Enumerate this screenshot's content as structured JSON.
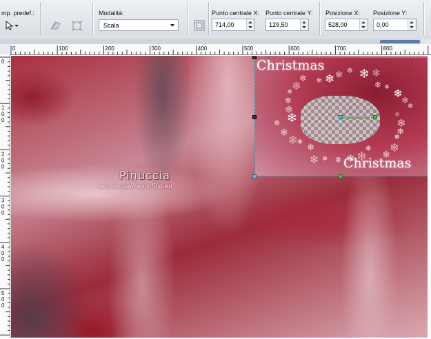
{
  "toolbar": {
    "preset_label": "mp. predef.:",
    "mode_label": "Modalità:",
    "mode_value": "Scala",
    "center_x_label": "Punto centrale X:",
    "center_x_value": "714,00",
    "center_y_label": "Punto centrale Y:",
    "center_y_value": "129,50",
    "pos_x_label": "Posizione X:",
    "pos_x_value": "528,00",
    "pos_y_label": "Posizione Y:",
    "pos_y_value": "0,00"
  },
  "ruler_top_ticks": [
    "0",
    "100",
    "200",
    "300",
    "400",
    "500",
    "600",
    "700",
    "800"
  ],
  "ruler_left_ticks": [
    "0",
    "1\n0\n0",
    "2\n0\n0",
    "3\n0\n0",
    "4\n0\n0",
    "5\n0\n0"
  ],
  "canvas": {
    "watermark_name": "Pinuccia",
    "watermark_url": "www.maidiregrafica.eu",
    "layer_title_top": "Christmas",
    "layer_title_bottom": "Christmas"
  },
  "icons": {
    "pointer": "pointer-arrow-icon",
    "flip": "flip-icon",
    "transform": "transform-icon",
    "grid": "grid-icon"
  }
}
